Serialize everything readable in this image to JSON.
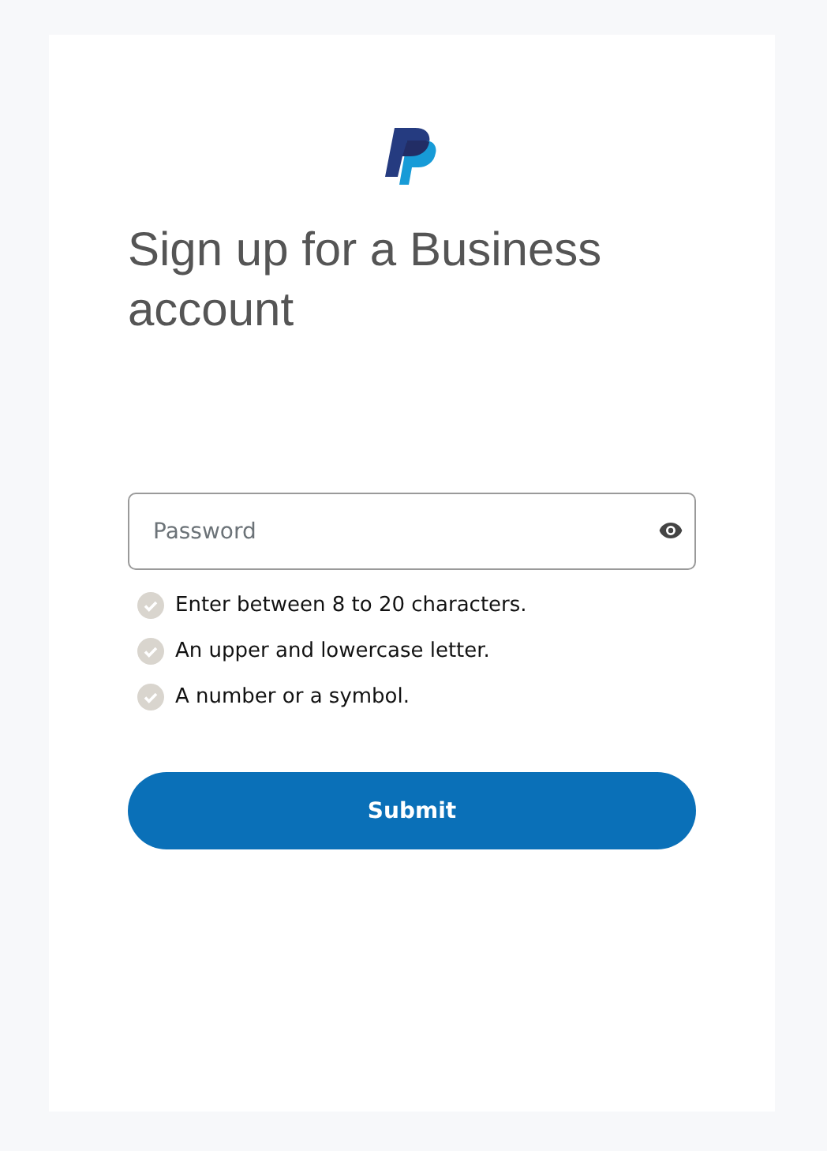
{
  "title": "Sign up for a Business account",
  "password": {
    "placeholder": "Password"
  },
  "rules": [
    {
      "text": "Enter between 8 to 20 characters.",
      "met": false
    },
    {
      "text": "An upper and lowercase letter.",
      "met": false
    },
    {
      "text": "A number or a symbol.",
      "met": false
    }
  ],
  "submit": "Submit"
}
